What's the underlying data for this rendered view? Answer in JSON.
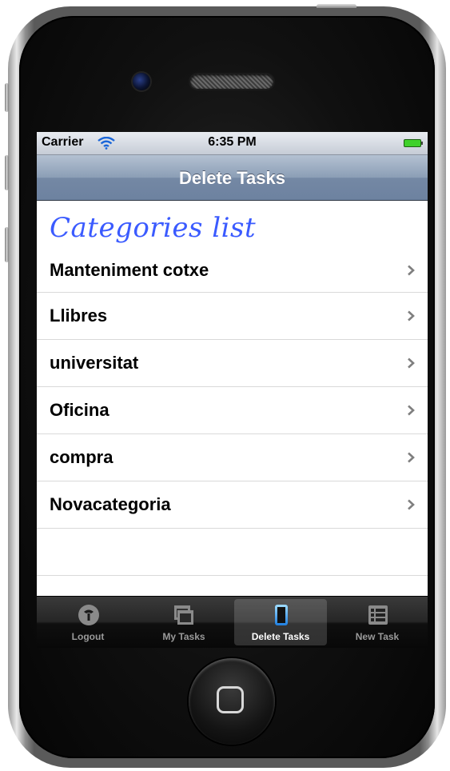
{
  "status_bar": {
    "carrier": "Carrier",
    "time": "6:35 PM"
  },
  "nav": {
    "title": "Delete Tasks"
  },
  "section_title": "Categories list",
  "categories": [
    "Manteniment cotxe",
    "Llibres",
    "universitat",
    "Oficina",
    "compra",
    "Novacategoria"
  ],
  "tabs": [
    {
      "label": "Logout",
      "icon": "logout-icon"
    },
    {
      "label": "My Tasks",
      "icon": "my-tasks-icon"
    },
    {
      "label": "Delete Tasks",
      "icon": "delete-tasks-icon",
      "selected": true
    },
    {
      "label": "New Task",
      "icon": "new-task-icon"
    }
  ],
  "colors": {
    "section_title": "#3b5bff",
    "nav_bar": "#7488a4",
    "battery": "#3fd12b"
  }
}
